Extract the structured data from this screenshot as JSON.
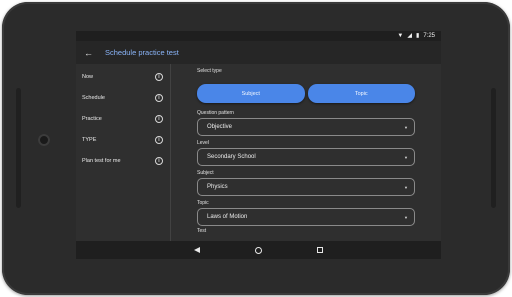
{
  "status": {
    "time": "7:25",
    "wifi_icon": "wifi-icon",
    "signal_icon": "signal-icon",
    "battery_icon": "battery-icon"
  },
  "appbar": {
    "title": "Schedule practice test",
    "back_icon": "arrow-back-icon"
  },
  "sidebar": {
    "items": [
      {
        "label": "Now"
      },
      {
        "label": "Schedule"
      },
      {
        "label": "Practice"
      },
      {
        "label": "TYPE"
      },
      {
        "label": "Plan test for me"
      }
    ]
  },
  "main": {
    "select_type_label": "Select type",
    "toggles": {
      "subject": "Subject",
      "topic": "Topic"
    },
    "fields": [
      {
        "label": "Question pattern",
        "value": "Objective"
      },
      {
        "label": "Level",
        "value": "Secondary School"
      },
      {
        "label": "Subject",
        "value": "Physics"
      },
      {
        "label": "Topic",
        "value": "Laws of Motion"
      }
    ],
    "cut_label": "Test"
  },
  "colors": {
    "accent": "#4a86e8",
    "title": "#8ab4f8",
    "background": "#2f2f2f"
  }
}
